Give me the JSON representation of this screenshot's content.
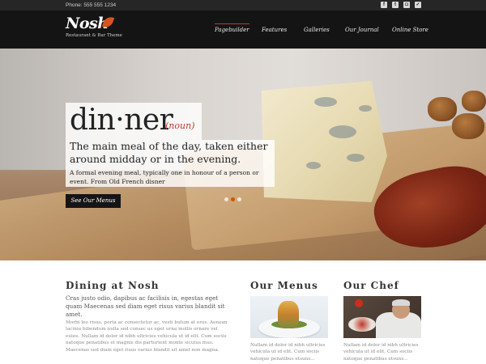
{
  "topbar": {
    "phone": "Phone: 555 555 1234",
    "social_icons": [
      "facebook-icon",
      "twitter-icon",
      "instagram-icon",
      "foursquare-icon"
    ]
  },
  "header": {
    "logo_name": "Nosh",
    "logo_tagline": "Restaurant & Bar Theme",
    "nav": [
      {
        "label": "Pagebuilder",
        "active": true
      },
      {
        "label": "Features",
        "active": false
      },
      {
        "label": "Galleries",
        "active": false
      },
      {
        "label": "Our Journal",
        "active": false
      },
      {
        "label": "Online Store",
        "active": false
      }
    ]
  },
  "hero": {
    "word": "din·ner",
    "pos": "(noun)",
    "meaning": "The main meal of the day, taken either around midday or in the evening.",
    "note": "A formal evening meal, typically one in honour of a person or event. From Old French disner",
    "cta": "See Our Menus",
    "slides": 3,
    "active_slide": 1
  },
  "dining": {
    "title": "Dining at Nosh",
    "lead": "Cras justo odio, dapibus ac facilisis in, egestas eget quam Maecenas sed diam eget risus varius blandit sit amet.",
    "body": "Morbi leo risus, porta ac consectetur ac, vesti bulum at eros. Aenean lacinia bibendum nulla sed consec us eget urna mollis ornare vel eulee. Nullam id dolor id nibh ultricies vehicula ut id elit. Cum sociis natoque penatibus et magnis dis parturient monte siculus mus. Maecenas sed diam eget risus varius blandit sit amet non magna."
  },
  "menus": {
    "title": "Our Menus",
    "text": "Nullam id dolor id nibh ultricies vehicula ut id elit. Cum sociis natoque penatibus etsuns..."
  },
  "chef": {
    "title": "Our Chef",
    "text": "Nullam id dolor id nibh ultricies vehicula ut id elit. Cum sociis natoque penatibus etsuns..."
  },
  "colors": {
    "accent": "#c0392b",
    "header_bg": "#141414",
    "topbar_bg": "#262626"
  }
}
